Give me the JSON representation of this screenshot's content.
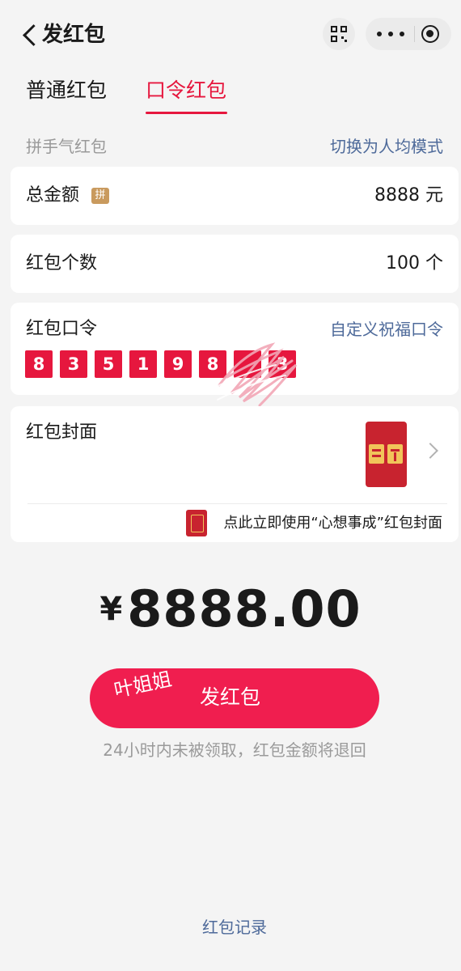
{
  "nav": {
    "title": "发红包"
  },
  "tabs": [
    {
      "label": "普通红包",
      "active": false
    },
    {
      "label": "口令红包",
      "active": true
    }
  ],
  "mode": {
    "label": "拼手气红包",
    "switch_text": "切换为人均模式"
  },
  "total": {
    "label": "总金额",
    "badge": "拼",
    "value": "8888 元"
  },
  "count": {
    "label": "红包个数",
    "value": "100 个"
  },
  "password": {
    "label": "红包口令",
    "custom_link": "自定义祝福口令",
    "digits": [
      "8",
      "3",
      "5",
      "1",
      "9",
      "8",
      "",
      "3"
    ]
  },
  "cover": {
    "label": "红包封面",
    "tip": "点此立即使用“心想事成”红包封面"
  },
  "amount": {
    "currency": "¥",
    "value": "8888.00"
  },
  "send_button": {
    "label": "发红包",
    "watermark": "叶姐姐"
  },
  "refund_tip": "24小时内未被领取，红包金额将退回",
  "record_link": "红包记录",
  "colors": {
    "accent": "#e6173e",
    "button": "#f01e4f",
    "link": "#4e6a9a",
    "background": "#f4f4f4"
  },
  "icons": [
    "back-arrow-icon",
    "scan-icon",
    "more-icon",
    "mini-program-close-icon",
    "chevron-right-icon",
    "red-envelope-cover-icon"
  ]
}
